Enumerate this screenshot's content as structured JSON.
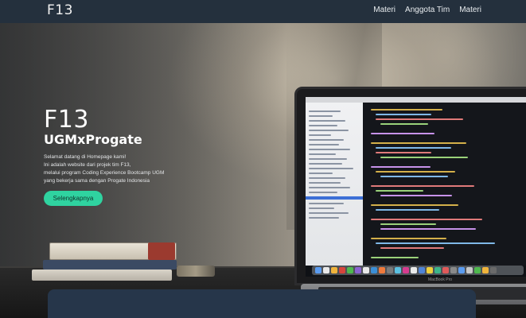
{
  "navbar": {
    "brand": "F13",
    "links": [
      "Materi",
      "Anggota Tim",
      "Materi"
    ]
  },
  "hero": {
    "title": "F13",
    "subtitle": "UGMxProgate",
    "description_lines": [
      "Selamat datang di Homepage kami!",
      "Ini adalah website dari projek tim F13,",
      "melalui program Coding Experience Bootcamp UGM",
      "yang bekerja sama dengan Progate Indonesia"
    ],
    "cta_label": "Selengkapnya"
  },
  "colors": {
    "navbar_bg": "#24303d",
    "accent": "#2fd3a0",
    "card_bg": "#26364a"
  },
  "illustration": {
    "laptop_label": "MacBook Pro"
  }
}
